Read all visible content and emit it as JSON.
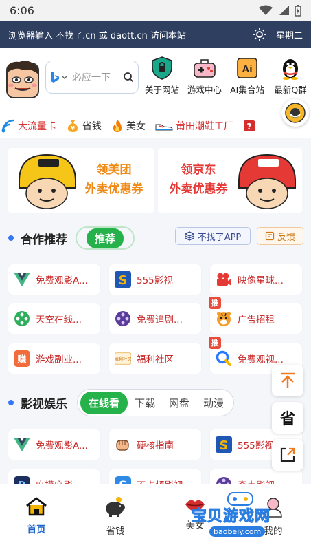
{
  "status": {
    "time": "6:06"
  },
  "topbar": {
    "message": "浏览器输入 不找了.cn 或 daott.cn 访问本站",
    "weekday": "星期二"
  },
  "search": {
    "placeholder": "必应一下"
  },
  "quick_links": [
    {
      "label": "关于网站",
      "icon": "lock-shield-icon"
    },
    {
      "label": "游戏中心",
      "icon": "gamepad-icon"
    },
    {
      "label": "AI集合站",
      "icon": "ai-icon"
    },
    {
      "label": "最新Q群",
      "icon": "qq-penguin-icon"
    }
  ],
  "strip": [
    {
      "label": "大流量卡",
      "icon": "signal-icon"
    },
    {
      "label": "省钱",
      "icon": "money-bag-icon"
    },
    {
      "label": "美女",
      "icon": "fire-icon"
    },
    {
      "label": "莆田潮鞋工厂",
      "icon": "sneaker-icon"
    },
    {
      "label": "?",
      "icon": "question-icon"
    }
  ],
  "banners": [
    {
      "line1": "领美团",
      "line2": "外卖优惠券"
    },
    {
      "line1": "领京东",
      "line2": "外卖优惠券"
    }
  ],
  "section1": {
    "title": "合作推荐",
    "pill": "推荐",
    "app_button": "不找了APP",
    "feedback_button": "反馈"
  },
  "cards1": [
    {
      "label": "免费观影A...",
      "icon": "vue-icon"
    },
    {
      "label": "555影视",
      "icon": "s-logo-icon"
    },
    {
      "label": "映像星球...",
      "icon": "camera-icon"
    },
    {
      "label": "天空在线...",
      "icon": "film-reel-icon"
    },
    {
      "label": "免费追剧...",
      "icon": "film-reel-icon"
    },
    {
      "label": "广告招租",
      "icon": "tiger-icon",
      "badge": "推"
    },
    {
      "label": "游戏副业...",
      "icon": "zhuan-icon"
    },
    {
      "label": "福利社区",
      "icon": "fuli-icon"
    },
    {
      "label": "免费观视...",
      "icon": "q-search-icon",
      "badge": "推"
    }
  ],
  "section2": {
    "title": "影视娱乐",
    "tabs": [
      "在线看",
      "下载",
      "网盘",
      "动漫"
    ]
  },
  "cards2": [
    {
      "label": "免费观影A...",
      "icon": "vue-icon"
    },
    {
      "label": "硬核指南",
      "icon": "fist-icon"
    },
    {
      "label": "555影视",
      "icon": "s-logo-icon"
    },
    {
      "label": "麻摸麻影",
      "icon": "d-logo-icon"
    },
    {
      "label": "不卡顿影视",
      "icon": "blue-s-icon"
    },
    {
      "label": "奇点影视",
      "icon": "film-reel-icon"
    }
  ],
  "float_buttons": {
    "top": "↑",
    "save": "省",
    "share": "share-icon"
  },
  "bottom_nav": [
    {
      "label": "首页",
      "active": true
    },
    {
      "label": "省钱",
      "active": false
    },
    {
      "label": "美女",
      "active": false
    },
    {
      "label": "我的",
      "active": false
    }
  ],
  "watermark": {
    "title": "宝贝游戏网",
    "url": "baobeiy.com"
  }
}
